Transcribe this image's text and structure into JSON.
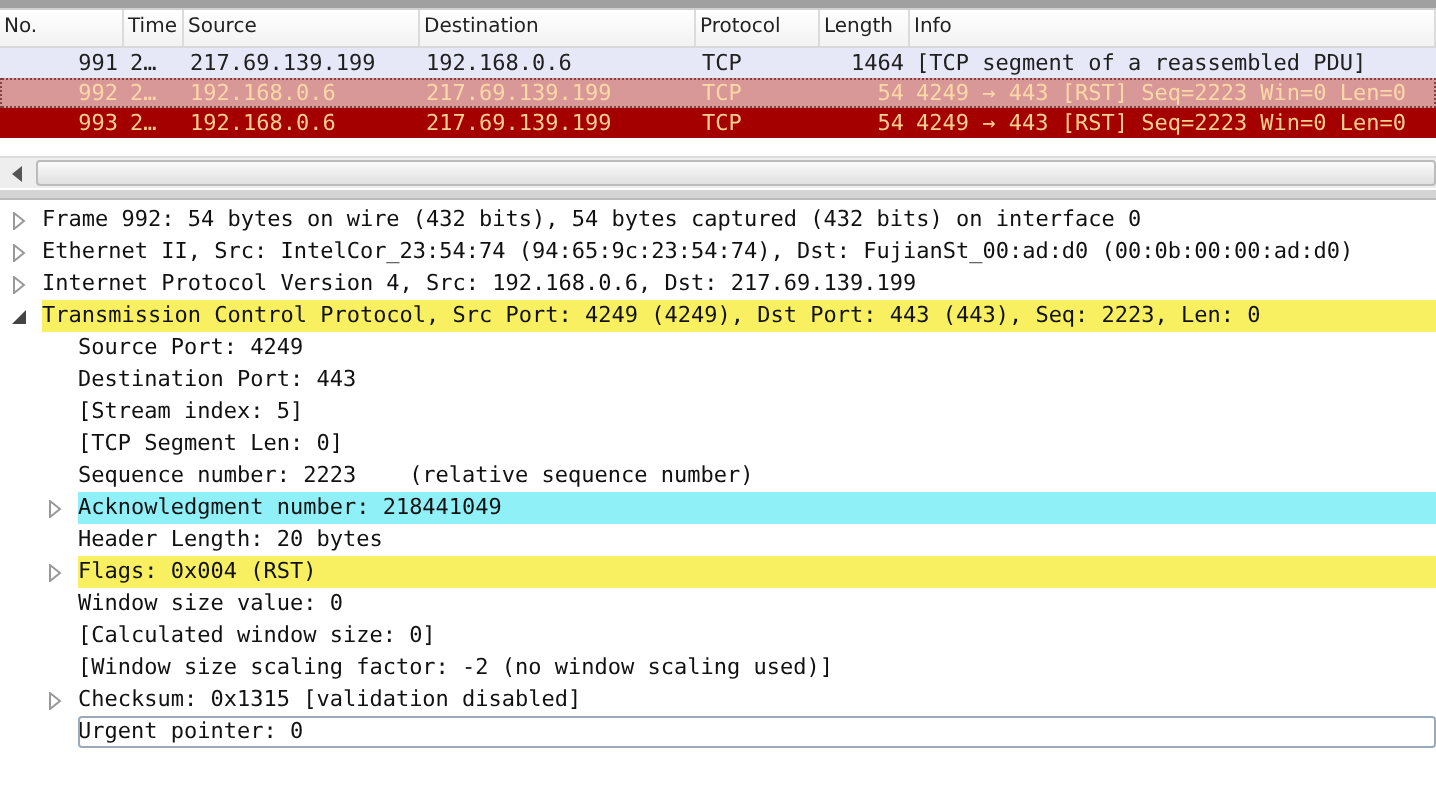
{
  "packet_list": {
    "columns": [
      "No.",
      "Time",
      "Source",
      "Destination",
      "Protocol",
      "Length",
      "Info"
    ],
    "rows": [
      {
        "cells": [
          "991",
          "2…",
          "217.69.139.199",
          "192.168.0.6",
          "TCP",
          "1464",
          "[TCP segment of a reassembled PDU]"
        ],
        "color": "#e6e8f8",
        "selected": false
      },
      {
        "cells": [
          "992",
          "2…",
          "192.168.0.6",
          "217.69.139.199",
          "TCP",
          "54",
          "4249 → 443 [RST] Seq=2223 Win=0 Len=0"
        ],
        "color": "#d89898",
        "selected": true
      },
      {
        "cells": [
          "993",
          "2…",
          "192.168.0.6",
          "217.69.139.199",
          "TCP",
          "54",
          "4249 → 443 [RST] Seq=2223 Win=0 Len=0"
        ],
        "color": "#a40000",
        "selected": false
      }
    ]
  },
  "details": [
    {
      "text": "Frame 992: 54 bytes on wire (432 bits), 54 bytes captured (432 bits) on interface 0",
      "expanded": false
    },
    {
      "text": "Ethernet II, Src: IntelCor_23:54:74 (94:65:9c:23:54:74), Dst: FujianSt_00:ad:d0 (00:0b:00:00:ad:d0)",
      "expanded": false
    },
    {
      "text": "Internet Protocol Version 4, Src: 192.168.0.6, Dst: 217.69.139.199",
      "expanded": false
    },
    {
      "text": "Transmission Control Protocol, Src Port: 4249 (4249), Dst Port: 443 (443), Seq: 2223, Len: 0",
      "expanded": true,
      "color": "#f8f060",
      "children": [
        {
          "text": "Source Port: 4249"
        },
        {
          "text": "Destination Port: 443"
        },
        {
          "text": "[Stream index: 5]"
        },
        {
          "text": "[TCP Segment Len: 0]"
        },
        {
          "text": "Sequence number: 2223    (relative sequence number)"
        },
        {
          "text": "Acknowledgment number: 218441049",
          "expanded": false,
          "color": "#90f0f8"
        },
        {
          "text": "Header Length: 20 bytes"
        },
        {
          "text": "Flags: 0x004 (RST)",
          "expanded": false,
          "color": "#f8f060"
        },
        {
          "text": "Window size value: 0"
        },
        {
          "text": "[Calculated window size: 0]"
        },
        {
          "text": "[Window size scaling factor: -2 (no window scaling used)]"
        },
        {
          "text": "Checksum: 0x1315 [validation disabled]",
          "expanded": false
        },
        {
          "text": "Urgent pointer: 0",
          "focused": true
        }
      ]
    }
  ]
}
